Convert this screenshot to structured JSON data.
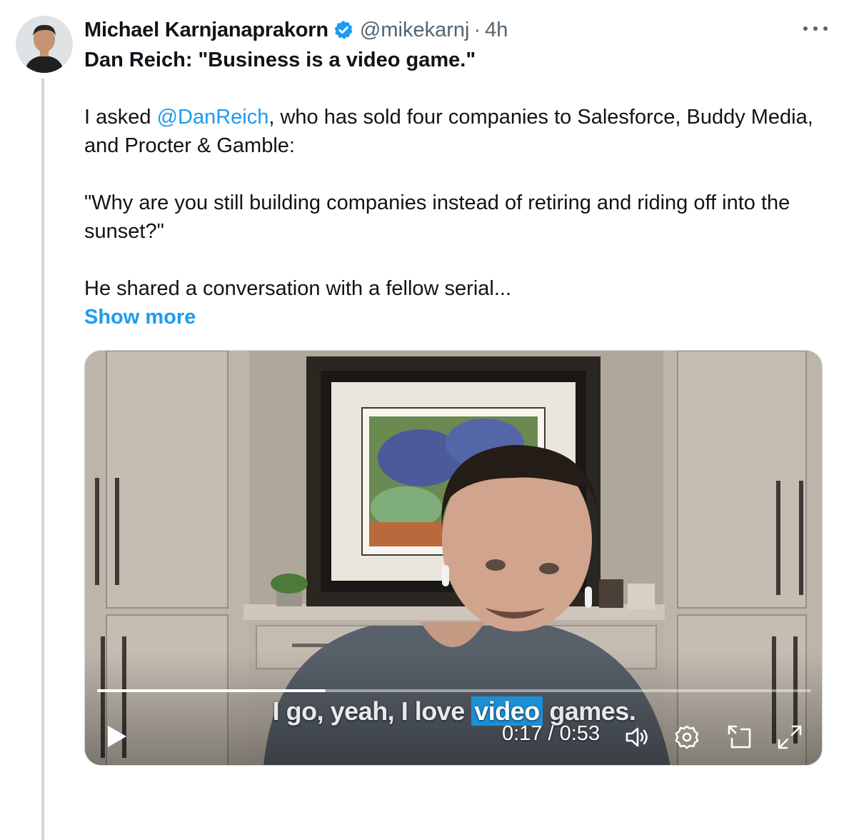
{
  "tweet": {
    "author_name": "Michael Karnjanaprakorn",
    "handle": "@mikekarnj",
    "separator": "·",
    "time": "4h",
    "verified": true,
    "avatar_icon": "profile-photo",
    "more_icon": "ellipsis-icon",
    "headline": "Dan Reich: \"Business is a video game.\"",
    "para1_before": "I asked ",
    "para1_mention": "@DanReich",
    "para1_after": ", who has sold four companies to Salesforce, Buddy Media, and Procter & Gamble:",
    "para2": "\"Why are you still building companies instead of retiring and riding off into the sunset?\"",
    "para3": "He shared a conversation with a fellow serial...",
    "show_more": "Show more"
  },
  "video": {
    "caption_before": "I go, yeah, I love ",
    "caption_highlight": "video",
    "caption_after": " games.",
    "current_time": "0:17",
    "time_separator": " / ",
    "duration": "0:53",
    "progress_fraction": 0.32,
    "icons": [
      "play-icon",
      "volume-icon",
      "settings-icon",
      "picture-in-picture-icon",
      "fullscreen-icon"
    ]
  },
  "colors": {
    "link": "#1d9bf0",
    "text": "#0f1419",
    "muted": "#536471",
    "caption_highlight": "#1d8fd6"
  }
}
